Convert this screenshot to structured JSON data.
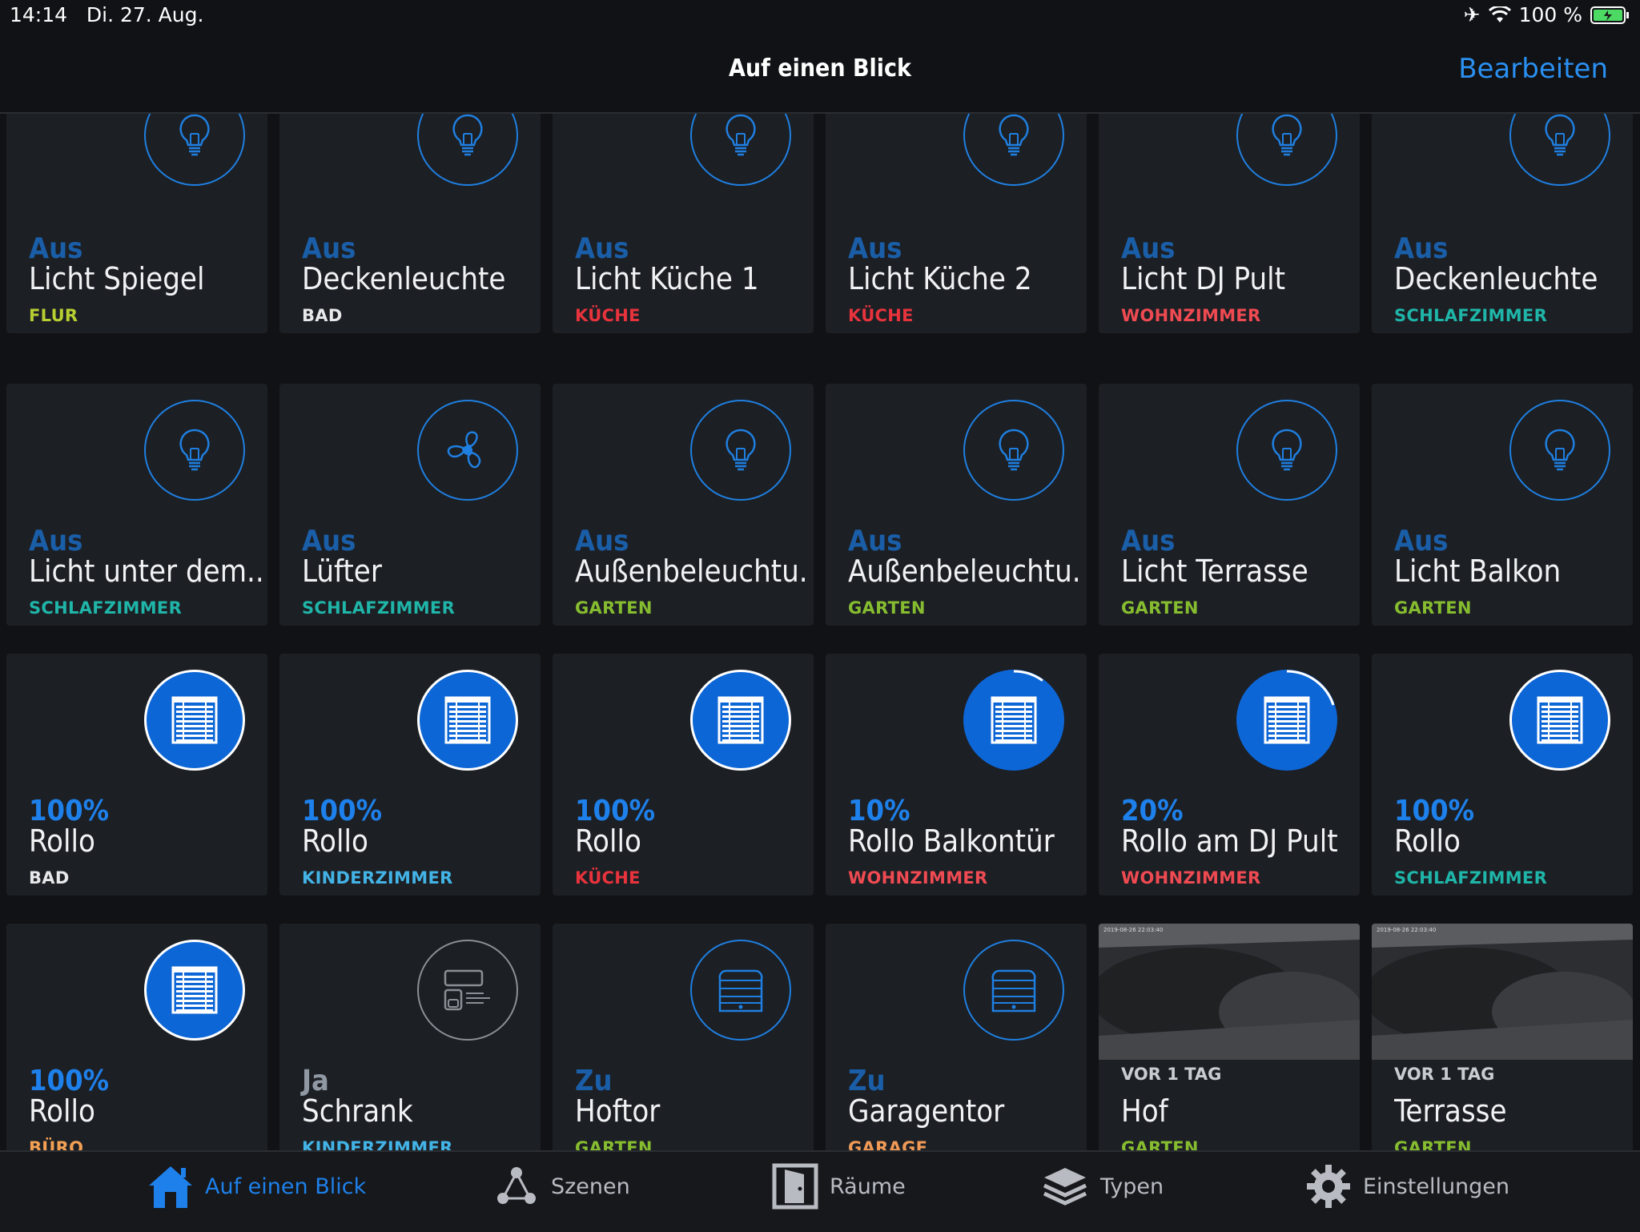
{
  "status": {
    "time": "14:14",
    "date": "Di. 27. Aug.",
    "battery": "100 %"
  },
  "nav": {
    "title": "Auf einen Blick",
    "edit": "Bearbeiten"
  },
  "colors": {
    "accent": "#1e80ea",
    "flur": "#b8cf32",
    "bad": "#e6e8ea",
    "kueche": "#e8333d",
    "wohnzimmer": "#ef4a52",
    "schlafzimmer": "#1fb5a8",
    "kinderzimmer": "#43b3e6",
    "garten": "#86bc2f",
    "buero": "#f2a154",
    "garage": "#f09a56"
  },
  "tiles": [
    {
      "state": "Aus",
      "name": "Licht Spiegel",
      "room": "FLUR",
      "icon": "bulb-icon"
    },
    {
      "state": "Aus",
      "name": "Deckenleuchte",
      "room": "BAD",
      "icon": "bulb-icon"
    },
    {
      "state": "Aus",
      "name": "Licht Küche 1",
      "room": "KÜCHE",
      "icon": "bulb-icon"
    },
    {
      "state": "Aus",
      "name": "Licht Küche 2",
      "room": "KÜCHE",
      "icon": "bulb-icon"
    },
    {
      "state": "Aus",
      "name": "Licht DJ Pult",
      "room": "WOHNZIMMER",
      "icon": "bulb-icon"
    },
    {
      "state": "Aus",
      "name": "Deckenleuchte",
      "room": "SCHLAFZIMMER",
      "icon": "bulb-icon"
    },
    {
      "state": "Aus",
      "name": "Licht unter dem...",
      "room": "SCHLAFZIMMER",
      "icon": "bulb-icon"
    },
    {
      "state": "Aus",
      "name": "Lüfter",
      "room": "SCHLAFZIMMER",
      "icon": "fan-icon"
    },
    {
      "state": "Aus",
      "name": "Außenbeleuchtu...",
      "room": "GARTEN",
      "icon": "bulb-icon"
    },
    {
      "state": "Aus",
      "name": "Außenbeleuchtu...",
      "room": "GARTEN",
      "icon": "bulb-icon"
    },
    {
      "state": "Aus",
      "name": "Licht Terrasse",
      "room": "GARTEN",
      "icon": "bulb-icon"
    },
    {
      "state": "Aus",
      "name": "Licht Balkon",
      "room": "GARTEN",
      "icon": "bulb-icon"
    },
    {
      "state": "100%",
      "name": "Rollo",
      "room": "BAD",
      "icon": "blind-icon",
      "level": 1.0
    },
    {
      "state": "100%",
      "name": "Rollo",
      "room": "KINDERZIMMER",
      "icon": "blind-icon",
      "level": 1.0
    },
    {
      "state": "100%",
      "name": "Rollo",
      "room": "KÜCHE",
      "icon": "blind-icon",
      "level": 1.0
    },
    {
      "state": "10%",
      "name": "Rollo Balkontür",
      "room": "WOHNZIMMER",
      "icon": "blind-icon",
      "level": 0.1
    },
    {
      "state": "20%",
      "name": "Rollo am DJ Pult",
      "room": "WOHNZIMMER",
      "icon": "blind-icon",
      "level": 0.2
    },
    {
      "state": "100%",
      "name": "Rollo",
      "room": "SCHLAFZIMMER",
      "icon": "blind-icon",
      "level": 1.0
    },
    {
      "state": "100%",
      "name": "Rollo",
      "room": "BÜRO",
      "icon": "blind-icon",
      "level": 1.0
    },
    {
      "state": "Ja",
      "name": "Schrank",
      "room": "KINDERZIMMER",
      "icon": "cabinet-icon"
    },
    {
      "state": "Zu",
      "name": "Hoftor",
      "room": "GARTEN",
      "icon": "garage-door-icon"
    },
    {
      "state": "Zu",
      "name": "Garagentor",
      "room": "GARAGE",
      "icon": "garage-door-icon"
    },
    {
      "camera": "VOR 1 TAG",
      "name": "Hof",
      "room": "GARTEN",
      "icon": "camera-snapshot"
    },
    {
      "camera": "VOR 1 TAG",
      "name": "Terrasse",
      "room": "GARTEN",
      "icon": "camera-snapshot"
    }
  ],
  "tabs": [
    {
      "label": "Auf einen Blick",
      "icon": "home-icon",
      "active": true
    },
    {
      "label": "Szenen",
      "icon": "scenes-icon",
      "active": false
    },
    {
      "label": "Räume",
      "icon": "door-icon",
      "active": false
    },
    {
      "label": "Typen",
      "icon": "layers-icon",
      "active": false
    },
    {
      "label": "Einstellungen",
      "icon": "gear-icon",
      "active": false
    }
  ]
}
